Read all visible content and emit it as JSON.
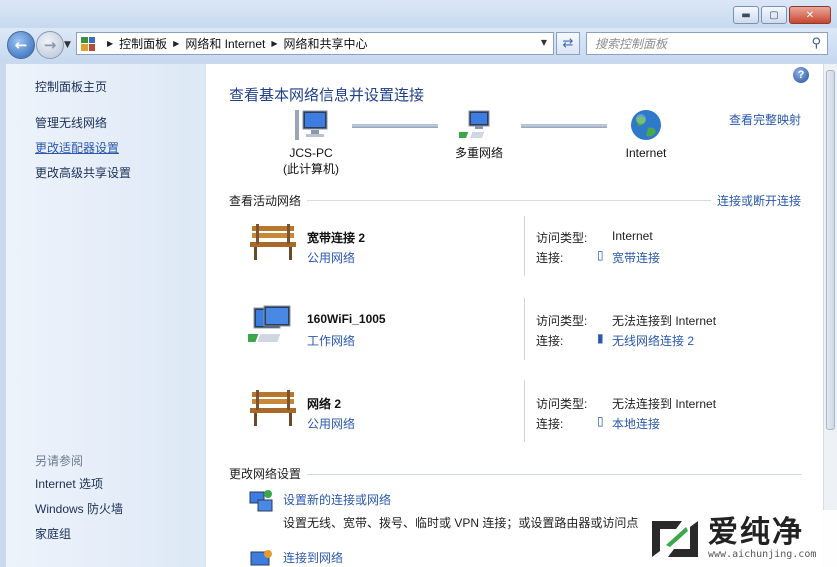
{
  "window": {
    "minimize_glyph": "▬",
    "maximize_glyph": "▢",
    "close_glyph": "✕"
  },
  "address": {
    "breadcrumbs": [
      "控制面板",
      "网络和 Internet",
      "网络和共享中心"
    ],
    "search_placeholder": "搜索控制面板"
  },
  "sidebar": {
    "items": [
      "控制面板主页",
      "管理无线网络",
      "更改适配器设置",
      "更改高级共享设置"
    ],
    "see_also_title": "另请参阅",
    "see_also": [
      "Internet 选项",
      "Windows 防火墙",
      "家庭组"
    ]
  },
  "main": {
    "title": "查看基本网络信息并设置连接",
    "full_map_link": "查看完整映射",
    "map_nodes": [
      {
        "label": "JCS-PC",
        "sub": "(此计算机)",
        "icon": "computer-icon"
      },
      {
        "label": "多重网络",
        "sub": "",
        "icon": "network-icon"
      },
      {
        "label": "Internet",
        "sub": "",
        "icon": "globe-icon"
      }
    ],
    "active_networks_title": "查看活动网络",
    "connect_disconnect_link": "连接或断开连接",
    "access_type_label": "访问类型:",
    "connection_label": "连接:",
    "networks": [
      {
        "name": "宽带连接  2",
        "type": "公用网络",
        "icon": "bench-icon",
        "access": "Internet",
        "connection": "宽带连接",
        "connection_icon": "modem-icon"
      },
      {
        "name": "160WiFi_1005",
        "type": "工作网络",
        "icon": "work-network-icon",
        "access": "无法连接到 Internet",
        "connection": "无线网络连接 2",
        "connection_icon": "wireless-signal-icon"
      },
      {
        "name": "网络  2",
        "type": "公用网络",
        "icon": "bench-icon",
        "access": "无法连接到 Internet",
        "connection": "本地连接",
        "connection_icon": "ethernet-icon"
      }
    ],
    "change_settings_title": "更改网络设置",
    "tasks": [
      {
        "label": "设置新的连接或网络",
        "desc": "设置无线、宽带、拨号、临时或 VPN 连接；或设置路由器或访问点",
        "icon": "new-connection-icon"
      },
      {
        "label": "连接到网络",
        "desc": "",
        "icon": "connect-network-icon"
      }
    ]
  },
  "watermark": {
    "brand": "爱纯净",
    "url": "www.aichunjing.com"
  }
}
